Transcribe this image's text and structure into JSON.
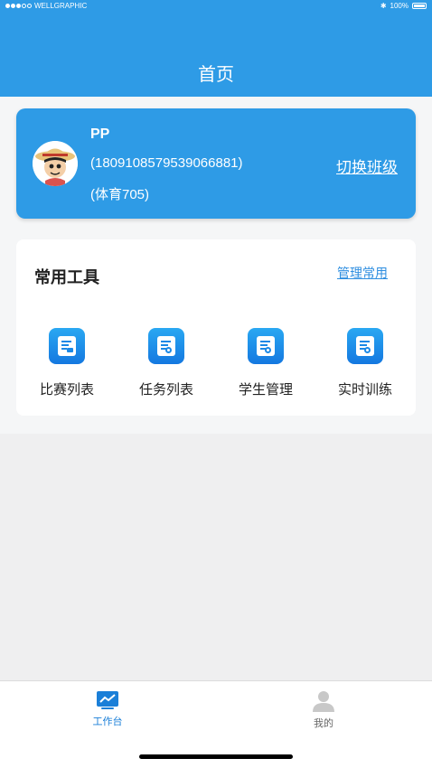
{
  "status_bar": {
    "carrier": "WELLGRAPHIC",
    "battery": "100%"
  },
  "header": {
    "title": "首页"
  },
  "profile": {
    "name": "PP",
    "phone": "(180910857953906688​1)",
    "class_name": "(体育705)",
    "switch_label": "切换班级"
  },
  "tools": {
    "title": "常用工具",
    "manage_label": "管理常用",
    "items": [
      {
        "label": "比赛列表",
        "icon": "competition-list-icon"
      },
      {
        "label": "任务列表",
        "icon": "task-list-icon"
      },
      {
        "label": "学生管理",
        "icon": "student-management-icon"
      },
      {
        "label": "实时训练",
        "icon": "realtime-training-icon"
      }
    ]
  },
  "tabbar": {
    "items": [
      {
        "label": "工作台",
        "active": true,
        "icon": "workbench-icon"
      },
      {
        "label": "我的",
        "active": false,
        "icon": "profile-icon"
      }
    ]
  },
  "colors": {
    "primary": "#2e9be6",
    "active_tab": "#1a7fd8",
    "inactive_tab": "#666666"
  }
}
